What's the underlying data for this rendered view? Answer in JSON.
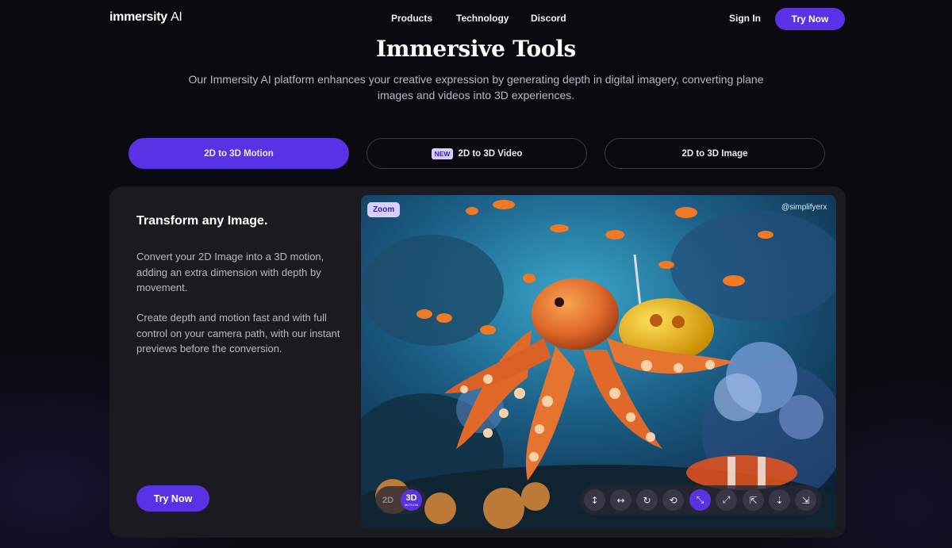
{
  "brand": {
    "name": "immersity",
    "suffix": "AI"
  },
  "nav": {
    "products": "Products",
    "technology": "Technology",
    "discord": "Discord",
    "sign_in": "Sign In",
    "try_now": "Try Now"
  },
  "hero": {
    "title": "Immersive Tools",
    "subtitle": "Our Immersity AI platform enhances your creative expression by generating depth in digital imagery, converting plane images and videos into 3D experiences."
  },
  "tabs": [
    {
      "label": "2D to 3D Motion",
      "active": true
    },
    {
      "label": "2D to 3D Video",
      "badge": "NEW",
      "active": false
    },
    {
      "label": "2D to 3D Image",
      "active": false
    }
  ],
  "feature": {
    "title": "Transform any Image.",
    "paragraph1": "Convert your 2D Image into a 3D motion, adding an extra dimension with depth by movement.",
    "paragraph2": "Create depth and motion fast and with full control on your camera path, with our instant previews before the conversion.",
    "cta": "Try Now"
  },
  "preview": {
    "zoom_label": "Zoom",
    "credit": "@simplifyerx",
    "mode_2d": "2D",
    "mode_3d": "3D",
    "mode_3d_sub": "MOTION",
    "controls": [
      "vertical-move-icon",
      "horizontal-move-icon",
      "circle-orbit-icon",
      "swing-orbit-icon",
      "zoom-in-icon",
      "zoom-out-icon",
      "dolly-left-icon",
      "dolly-center-icon",
      "dolly-right-icon"
    ],
    "active_control": "zoom-in-icon"
  },
  "colors": {
    "accent": "#5a32e6",
    "badge_bg": "#d8cefb",
    "page_bg": "#0b0a10",
    "card_bg": "#1a1a20"
  }
}
